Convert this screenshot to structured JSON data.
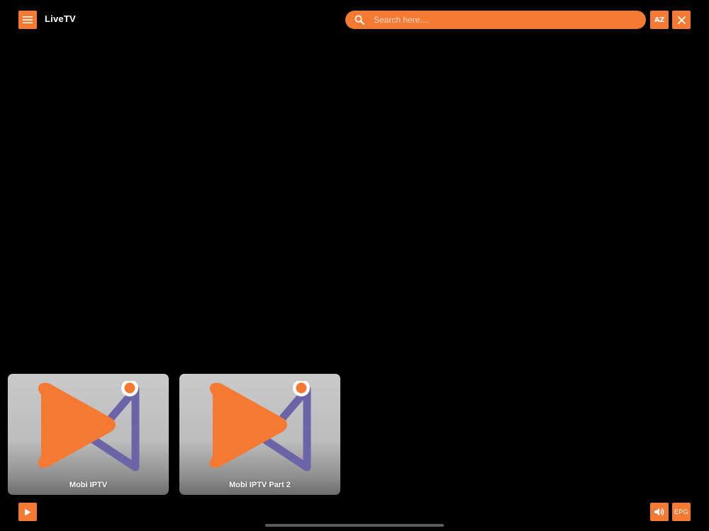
{
  "header": {
    "title": "LiveTV",
    "search": {
      "placeholder": "Search here....",
      "value": ""
    },
    "sort_label": "AZ"
  },
  "channels": [
    {
      "name": "Mobi IPTV"
    },
    {
      "name": "Mobi IPTV Part 2"
    }
  ],
  "footer": {
    "epg_label": "EPG"
  },
  "colors": {
    "accent": "#f47a34",
    "logo_secondary": "#6b64a6",
    "background": "#000000"
  },
  "icons": {
    "menu": "hamburger-menu-icon",
    "search": "search-icon",
    "sort": "sort-az-icon",
    "close": "close-icon",
    "play": "play-icon",
    "volume": "volume-icon",
    "channel_logo": "mobi-iptv-logo"
  }
}
